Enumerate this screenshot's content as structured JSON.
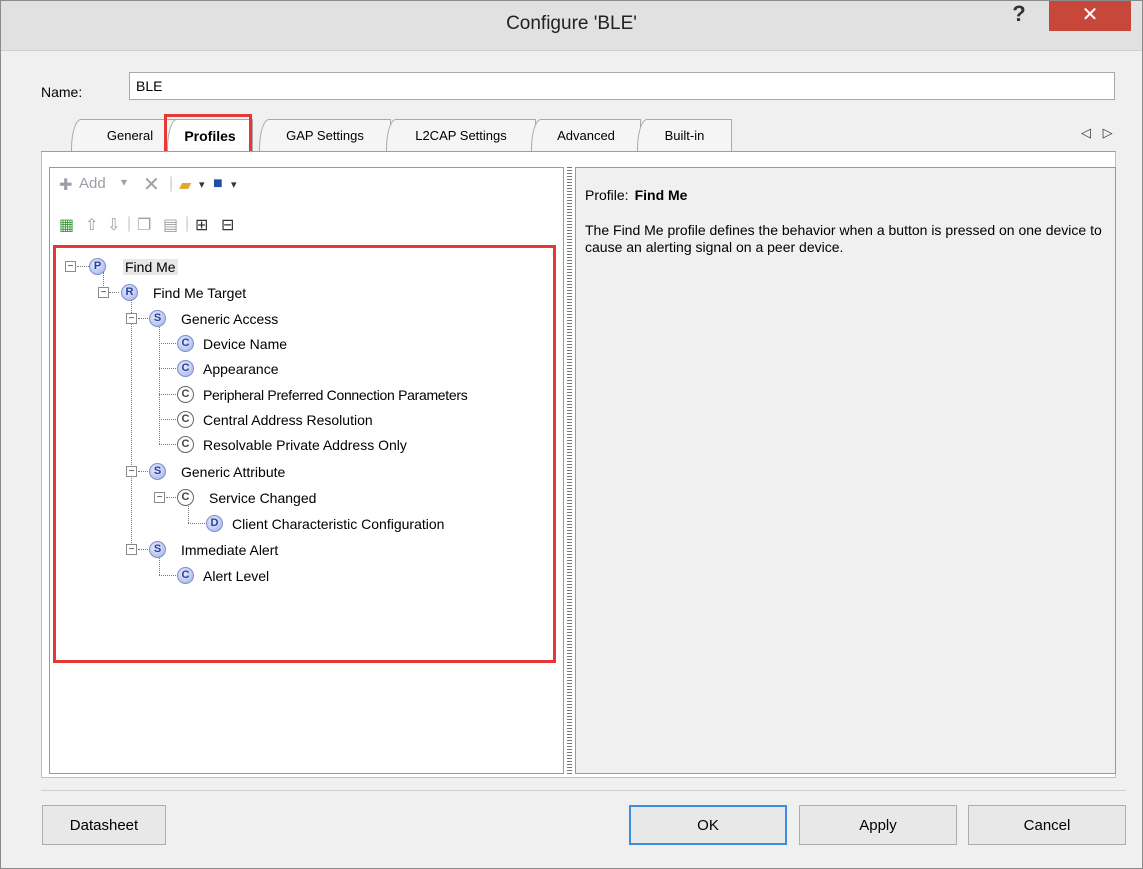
{
  "window": {
    "title": "Configure 'BLE'",
    "help_glyph": "?",
    "close_glyph": "✕"
  },
  "name_field": {
    "label": "Name:",
    "value": "BLE"
  },
  "tabs": [
    {
      "label": "General"
    },
    {
      "label": "Profiles",
      "active": true
    },
    {
      "label": "GAP Settings"
    },
    {
      "label": "L2CAP Settings"
    },
    {
      "label": "Advanced"
    },
    {
      "label": "Built-in"
    }
  ],
  "tab_scroll_glyphs": "◁ ▷",
  "toolbar": {
    "add_label": "Add",
    "add_dropdown": "▾",
    "delete_glyph": "✕"
  },
  "tree": {
    "nodes": [
      {
        "badge": "P",
        "label": "Find Me"
      },
      {
        "badge": "R",
        "label": "Find Me Target"
      },
      {
        "badge": "S",
        "label": "Generic Access"
      },
      {
        "badge": "C",
        "label": "Device Name"
      },
      {
        "badge": "C",
        "label": "Appearance"
      },
      {
        "badge": "C",
        "label": "Peripheral Preferred Connection Parameters"
      },
      {
        "badge": "C",
        "label": "Central Address Resolution"
      },
      {
        "badge": "C",
        "label": "Resolvable Private Address Only"
      },
      {
        "badge": "S",
        "label": "Generic Attribute"
      },
      {
        "badge": "C",
        "label": "Service Changed"
      },
      {
        "badge": "D",
        "label": "Client Characteristic Configuration"
      },
      {
        "badge": "S",
        "label": "Immediate Alert"
      },
      {
        "badge": "C",
        "label": "Alert Level"
      }
    ]
  },
  "details": {
    "caption": "Profile:",
    "profile_name": "Find Me",
    "description": "The Find Me profile defines the behavior when a button is pressed on one device to cause an alerting signal on a peer device."
  },
  "buttons": {
    "datasheet": "Datasheet",
    "ok": "OK",
    "apply": "Apply",
    "cancel": "Cancel"
  },
  "colors": {
    "highlight": "#e53935",
    "close_button": "#c7473a",
    "default_button_border": "#3c8ee0"
  }
}
